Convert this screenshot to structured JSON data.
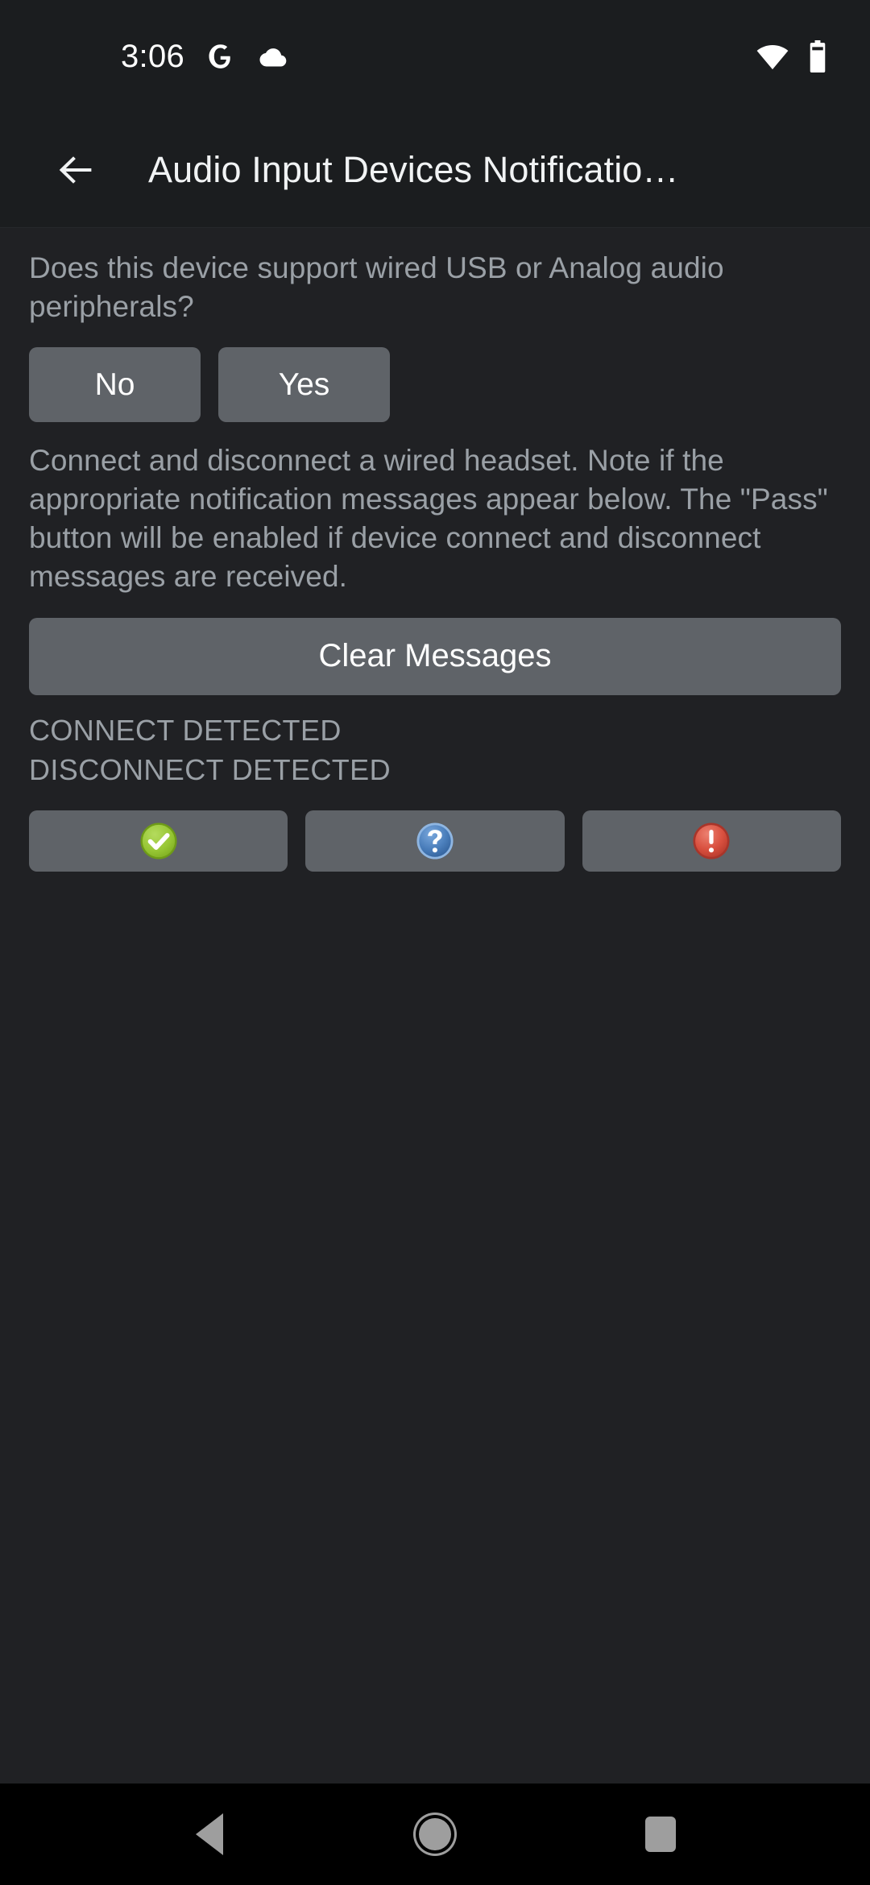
{
  "statusbar": {
    "clock": "3:06",
    "icons_left": [
      "google-g-icon",
      "cloud-icon"
    ],
    "icons_right": [
      "wifi-icon",
      "battery-icon"
    ]
  },
  "appbar": {
    "back_icon": "back-arrow-icon",
    "title": "Audio Input Devices Notificatio…"
  },
  "content": {
    "question": "Does this device support wired USB or Analog audio peripherals?",
    "answers": [
      {
        "label": "No"
      },
      {
        "label": "Yes"
      }
    ],
    "instructions": "Connect and disconnect a wired headset. Note if the appropriate notification messages appear below. The \"Pass\" button will be enabled if device connect and disconnect messages are received.",
    "clear_button": {
      "label": "Clear Messages"
    },
    "messages": [
      "CONNECT DETECTED",
      "DISCONNECT DETECTED"
    ],
    "verdict_buttons": [
      {
        "name": "pass-button",
        "icon": "check-circle-icon",
        "color": "#9ac93a"
      },
      {
        "name": "info-button",
        "icon": "question-circle-icon",
        "color": "#4a7ebb"
      },
      {
        "name": "fail-button",
        "icon": "exclamation-circle-icon",
        "color": "#d9503f"
      }
    ]
  },
  "navbar": {
    "back": "nav-back-icon",
    "home": "nav-home-icon",
    "recents": "nav-recents-icon"
  },
  "colors": {
    "background": "#202124",
    "appbar": "#1b1d1f",
    "button": "#5f6368",
    "text_primary": "#f1f3f4",
    "text_secondary": "#9aa0a6",
    "navbar": "#000000"
  }
}
